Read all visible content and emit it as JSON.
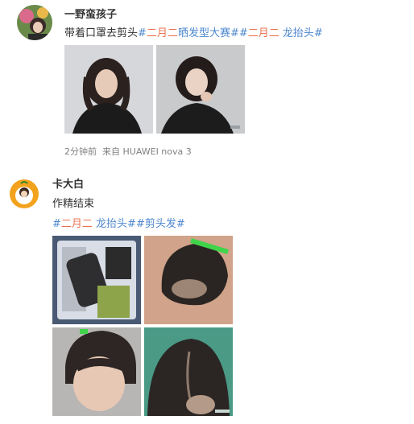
{
  "post1": {
    "username": "一野蛮孩子",
    "text_lead": "带着口罩去剪头",
    "tags": [
      {
        "text": "#",
        "color": "link"
      },
      {
        "text": "二月二",
        "color": "tag"
      },
      {
        "text": "晒发型大赛##",
        "color": "link"
      },
      {
        "text": "二月二",
        "color": "tag"
      },
      {
        "text": " 龙抬头#",
        "color": "link"
      }
    ],
    "timestamp": "2分钟前",
    "source": "来自 HUAWEI nova 3"
  },
  "post2": {
    "username": "卡大白",
    "text": "作精结束",
    "tags": [
      {
        "text": "#",
        "color": "link"
      },
      {
        "text": "二月二",
        "color": "tag"
      },
      {
        "text": " 龙抬头##剪头发#",
        "color": "link"
      }
    ]
  },
  "colors": {
    "tag": "#eb7350",
    "link": "#4e88cd",
    "meta": "#808080"
  }
}
